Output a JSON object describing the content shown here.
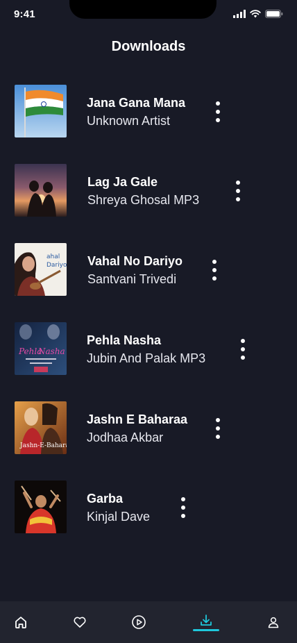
{
  "status": {
    "time": "9:41"
  },
  "header": {
    "title": "Downloads"
  },
  "songs": [
    {
      "title": "Jana Gana Mana",
      "artist": "Unknown Artist"
    },
    {
      "title": "Lag Ja Gale",
      "artist": "Shreya Ghosal  MP3"
    },
    {
      "title": "Vahal No Dariyo",
      "artist": "Santvani Trivedi"
    },
    {
      "title": "Pehla Nasha",
      "artist": "Jubin And Palak MP3"
    },
    {
      "title": "Jashn E Baharaa",
      "artist": "Jodhaa Akbar"
    },
    {
      "title": "Garba",
      "artist": "Kinjal Dave"
    }
  ],
  "nav": {
    "items": [
      {
        "icon": "home-icon"
      },
      {
        "icon": "heart-icon"
      },
      {
        "icon": "play-circle-icon"
      },
      {
        "icon": "download-icon",
        "active": true
      },
      {
        "icon": "profile-icon"
      }
    ]
  },
  "colors": {
    "background": "#181a26",
    "nav_background": "#22242f",
    "accent": "#1fc8dc"
  }
}
